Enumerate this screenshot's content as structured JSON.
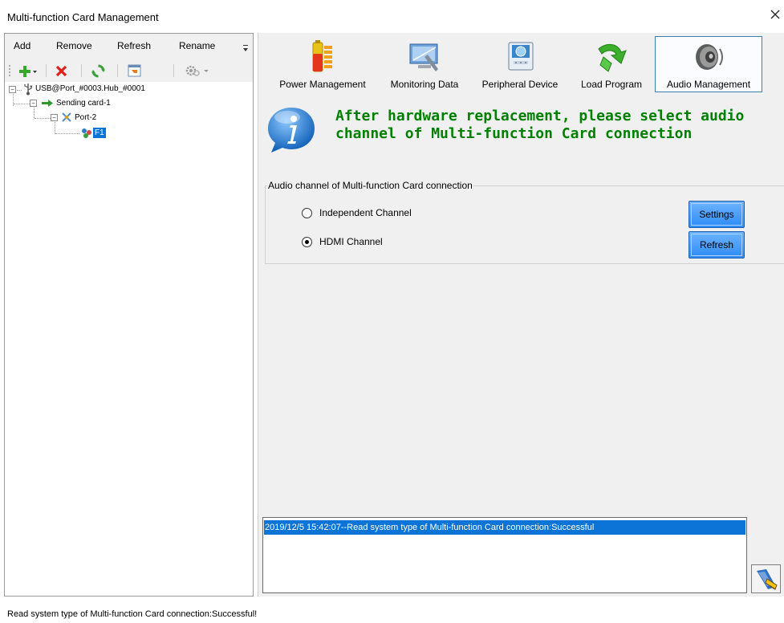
{
  "window": {
    "title": "Multi-function Card Management"
  },
  "left_panel": {
    "menu": [
      "Add",
      "Remove",
      "Refresh",
      "Rename"
    ],
    "tree": {
      "root": "USB@Port_#0003.Hub_#0001",
      "sending_card": "Sending card-1",
      "port": "Port-2",
      "card": "F1"
    }
  },
  "tabs": [
    {
      "label": "Power Management",
      "icon": "battery-icon"
    },
    {
      "label": "Monitoring Data",
      "icon": "monitor-icon"
    },
    {
      "label": "Peripheral Device",
      "icon": "camera-device-icon"
    },
    {
      "label": "Load Program",
      "icon": "green-arrow-icon"
    },
    {
      "label": "Audio Management",
      "icon": "speaker-icon",
      "active": true
    }
  ],
  "main": {
    "heading": "After hardware replacement, please select audio channel of Multi-function Card connection",
    "group_title": "Audio channel of Multi-function Card connection",
    "options": [
      {
        "label": "Independent Channel",
        "selected": false
      },
      {
        "label": "HDMI Channel",
        "selected": true
      }
    ],
    "settings_button": "Settings",
    "refresh_button": "Refresh",
    "log_entries": [
      "2019/12/5 15:42:07--Read system type of Multi-function Card connection:Successful"
    ]
  },
  "status": {
    "text": "Read system type of Multi-function Card connection:Successful!"
  },
  "colors": {
    "accent": "#0d74d7",
    "heading": "#008000",
    "button": "#2d8cf5"
  }
}
